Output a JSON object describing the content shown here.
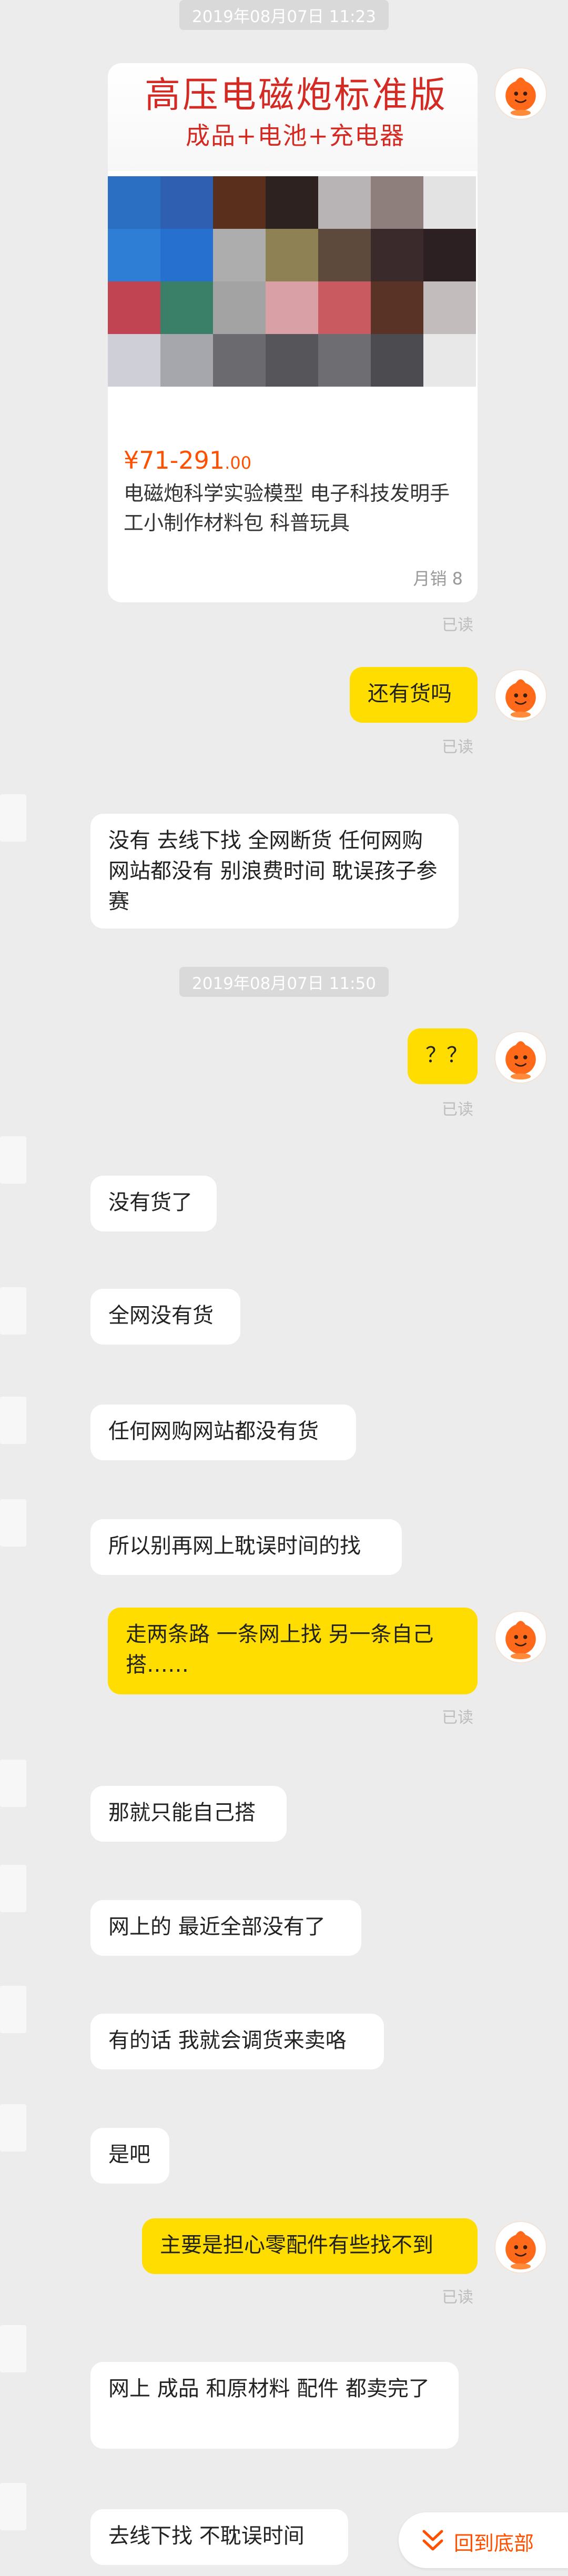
{
  "timestamps": [
    "2019年08月07日 11:23",
    "2019年08月07日 11:50"
  ],
  "product": {
    "banner_title": "高压电磁炮标准版",
    "banner_subtitle": "成品+电池+充电器",
    "price_prefix": "¥71-291",
    "price_suffix": ".00",
    "name": "电磁炮科学实验模型 电子科技发明手工小制作材料包 科普玩具",
    "sales": "月销 8"
  },
  "read_label": "已读",
  "messages": [
    {
      "side": "right",
      "text": "还有货吗"
    },
    {
      "side": "left",
      "text": "没有 去线下找  全网断货  任何网购网站都没有 别浪费时间 耽误孩子参赛"
    },
    {
      "side": "right",
      "text": "？？"
    },
    {
      "side": "left",
      "text": "没有货了"
    },
    {
      "side": "left",
      "text": "全网没有货"
    },
    {
      "side": "left",
      "text": "任何网购网站都没有货"
    },
    {
      "side": "left",
      "text": "所以别再网上耽误时间的找"
    },
    {
      "side": "right",
      "text": "走两条路 一条网上找 另一条自己搭……"
    },
    {
      "side": "left",
      "text": "那就只能自己搭"
    },
    {
      "side": "left",
      "text": "网上的 最近全部没有了"
    },
    {
      "side": "left",
      "text": "有的话 我就会调货来卖咯"
    },
    {
      "side": "left",
      "text": "是吧"
    },
    {
      "side": "right",
      "text": "主要是担心零配件有些找不到"
    },
    {
      "side": "left",
      "text": "网上 成品 和原材料 配件 都卖完了"
    },
    {
      "side": "left",
      "text": "去线下找  不耽误时间"
    }
  ],
  "back_to_bottom": "回到底部",
  "colors": {
    "accent": "#ff5000",
    "bubble_right": "#ffdd00",
    "bubble_left": "#ffffff",
    "background": "#ececec"
  }
}
